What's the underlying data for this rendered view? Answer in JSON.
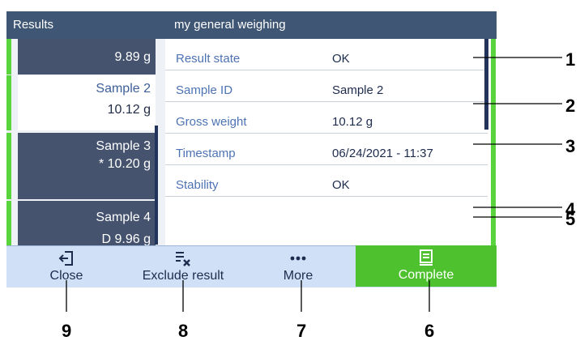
{
  "titlebar": {
    "left": "Results",
    "right": "my general weighing"
  },
  "sidebar": {
    "items": [
      {
        "label": "",
        "value": "9.89 g",
        "selected": false
      },
      {
        "label": "Sample 2",
        "value": "10.12 g",
        "selected": true
      },
      {
        "label": "Sample 3",
        "value": "* 10.20 g",
        "selected": false
      },
      {
        "label": "Sample 4",
        "value": "D 9.96 g",
        "selected": false
      }
    ]
  },
  "details": [
    {
      "key": "Result state",
      "value": "OK"
    },
    {
      "key": "Sample ID",
      "value": "Sample 2"
    },
    {
      "key": "Gross weight",
      "value": "10.12 g"
    },
    {
      "key": "Timestamp",
      "value": "06/24/2021 - 11:37"
    },
    {
      "key": "Stability",
      "value": "OK"
    }
  ],
  "toolbar": {
    "close": {
      "label": "Close",
      "icon": "exit-icon"
    },
    "exclude": {
      "label": "Exclude result",
      "icon": "exclude-list-icon"
    },
    "more": {
      "label": "More",
      "icon": "more-dots-icon"
    },
    "complete": {
      "label": "Complete",
      "icon": "document-icon"
    }
  },
  "colors": {
    "header": "#3f5674",
    "accent_green": "#4ec22e",
    "toolbar": "#cfe0f7",
    "label_blue": "#4d73b5"
  },
  "callouts": [
    "1",
    "2",
    "3",
    "4",
    "5",
    "6",
    "7",
    "8",
    "9"
  ]
}
